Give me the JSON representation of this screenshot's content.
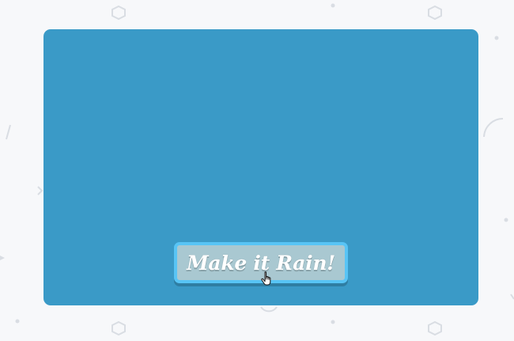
{
  "page": {
    "background": "#f7f8fa"
  },
  "card": {
    "color": "#3a9ac7"
  },
  "cta_button": {
    "label": "Make it Rain!",
    "background": "#a9c8d1",
    "border_color": "#58c4f5"
  },
  "icons": {
    "cursor": "pointer-hand-icon"
  }
}
